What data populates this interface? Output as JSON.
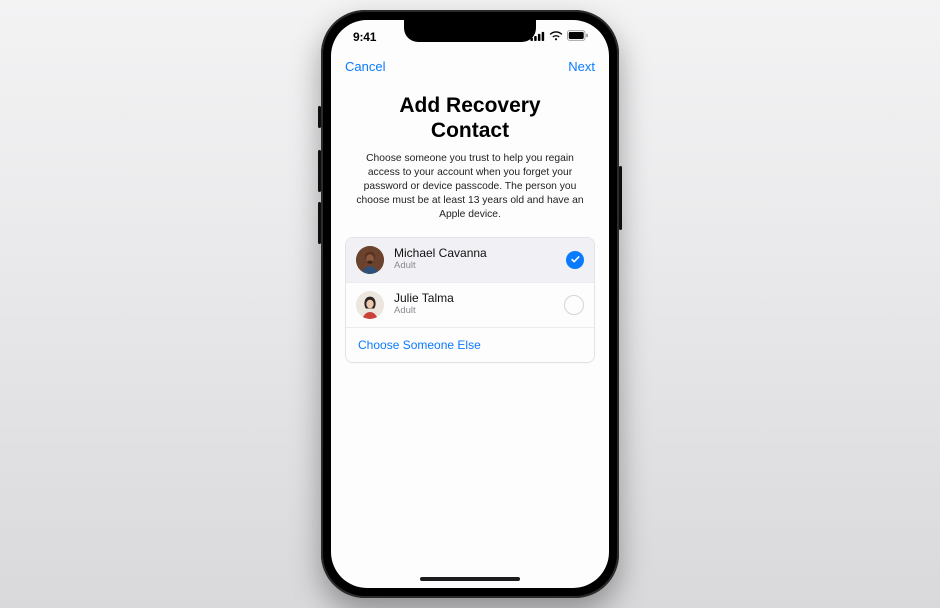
{
  "status_bar": {
    "time": "9:41"
  },
  "nav": {
    "cancel": "Cancel",
    "next": "Next"
  },
  "page": {
    "title_line1": "Add Recovery",
    "title_line2": "Contact",
    "description": "Choose someone you trust to help you regain access to your account when you forget your password or device passcode. The person you choose must be at least 13 years old and have an Apple device."
  },
  "contacts": [
    {
      "name": "Michael Cavanna",
      "subtitle": "Adult",
      "selected": true
    },
    {
      "name": "Julie Talma",
      "subtitle": "Adult",
      "selected": false
    }
  ],
  "choose_else": "Choose Someone Else",
  "colors": {
    "accent": "#0a7aff"
  }
}
